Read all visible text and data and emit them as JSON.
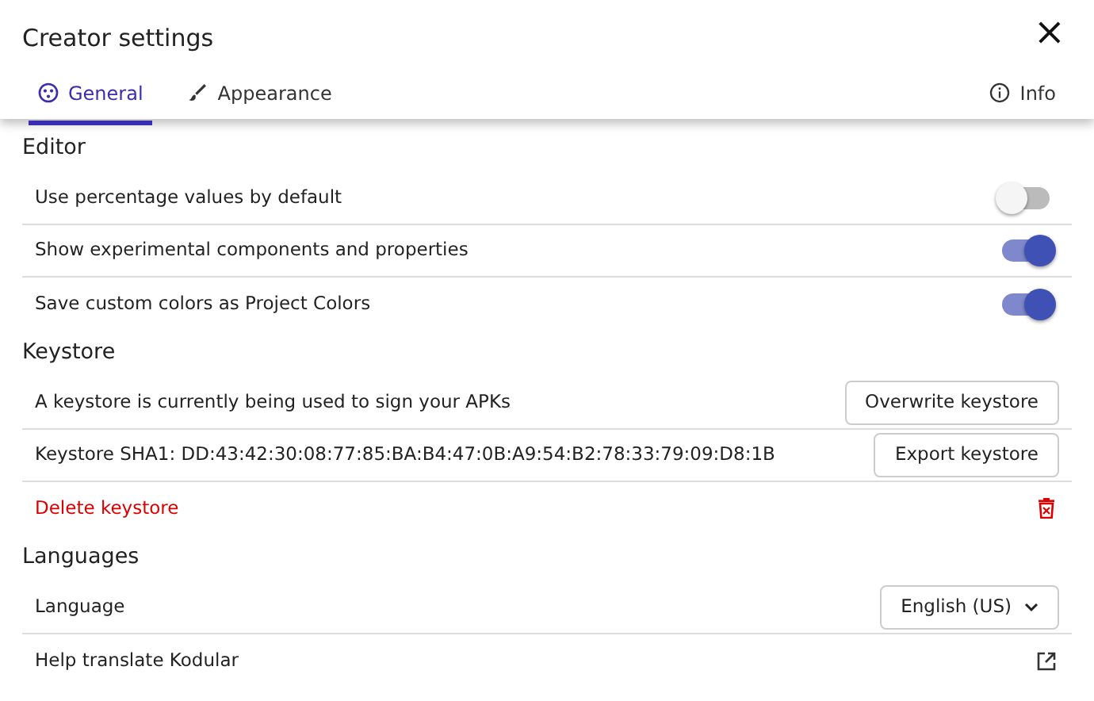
{
  "dialog": {
    "title": "Creator settings",
    "close": "×"
  },
  "tabs": [
    {
      "label": "General",
      "selected": true
    },
    {
      "label": "Appearance",
      "selected": false
    }
  ],
  "info_tab": {
    "label": "Info",
    "selected": false
  },
  "sections": [
    {
      "title": "Editor",
      "rows": [
        {
          "kind": "toggle",
          "label": "Use percentage values by default",
          "on": false
        },
        {
          "kind": "toggle",
          "label": "Show experimental components and properties",
          "on": true
        },
        {
          "kind": "toggle",
          "label": "Save custom colors as Project Colors",
          "on": true
        }
      ]
    },
    {
      "title": "Keystore",
      "rows": [
        {
          "kind": "button",
          "label": "A keystore is currently being used to sign your APKs",
          "button": "Overwrite keystore"
        },
        {
          "kind": "button",
          "label": "Keystore SHA1: DD:43:42:30:08:77:85:BA:B4:47:0B:A9:54:B2:78:33:79:09:D8:1B",
          "button": "Export keystore"
        },
        {
          "kind": "danger",
          "label": "Delete keystore"
        }
      ]
    },
    {
      "title": "Languages",
      "rows": [
        {
          "kind": "select",
          "label": "Language",
          "value": "English (US)"
        },
        {
          "kind": "link",
          "label": "Help translate Kodular"
        }
      ]
    }
  ]
}
